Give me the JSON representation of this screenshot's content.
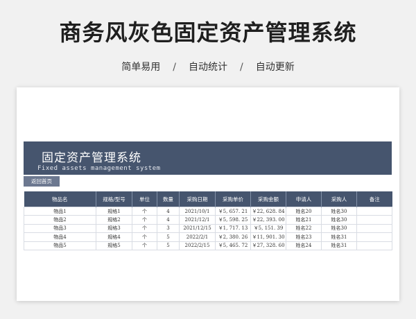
{
  "header": {
    "title": "商务风灰色固定资产管理系统",
    "tagline": [
      "简单易用",
      "自动统计",
      "自动更新"
    ],
    "separator": "/"
  },
  "sheet": {
    "banner_title": "固定资产管理系统",
    "banner_subtitle": "Fixed assets management system",
    "back_button": "返回首页",
    "columns": [
      "物品名",
      "规格/型号",
      "单位",
      "数量",
      "采购日期",
      "采购单价",
      "采购金额",
      "申请人",
      "采购人",
      "备注"
    ],
    "rows": [
      [
        "物品1",
        "规格1",
        "个",
        "4",
        "2021/10/1",
        "￥5, 657. 21",
        "￥22, 628. 84",
        "姓名20",
        "姓名30",
        ""
      ],
      [
        "物品2",
        "规格2",
        "个",
        "4",
        "2021/12/1",
        "￥5, 598. 25",
        "￥22, 393. 00",
        "姓名21",
        "姓名30",
        ""
      ],
      [
        "物品3",
        "规格3",
        "个",
        "3",
        "2021/12/15",
        "￥1, 717. 13",
        "￥5, 151. 39",
        "姓名22",
        "姓名30",
        ""
      ],
      [
        "物品4",
        "规格4",
        "个",
        "5",
        "2022/2/1",
        "￥2, 380. 26",
        "￥11, 901. 30",
        "姓名23",
        "姓名31",
        ""
      ],
      [
        "物品5",
        "规格5",
        "个",
        "5",
        "2022/2/15",
        "￥5, 465. 72",
        "￥27, 328. 60",
        "姓名24",
        "姓名31",
        ""
      ]
    ]
  },
  "colors": {
    "banner": "#46556e",
    "back_button": "#6c7890",
    "background": "#f1f1f1"
  }
}
